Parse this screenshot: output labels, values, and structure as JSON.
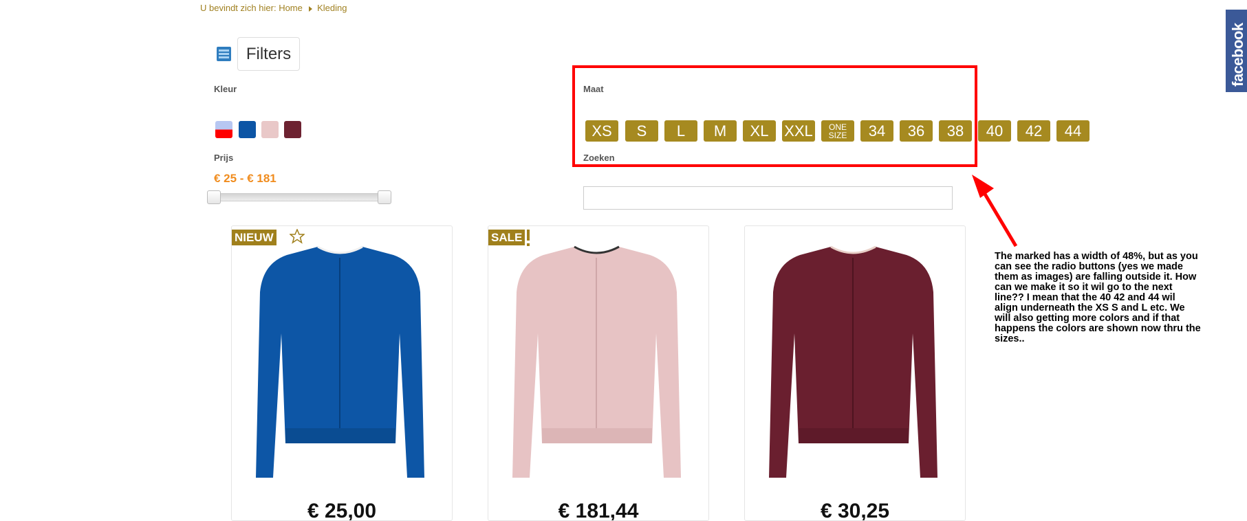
{
  "breadcrumb": {
    "prefix": "U bevindt zich hier:",
    "home": "Home",
    "current": "Kleding"
  },
  "filters": {
    "title": "Filters",
    "kleur_label": "Kleur",
    "colors": [
      "#b7c7f2/#ff0000",
      "#0c55a5",
      "#e9c8c8",
      "#6d2231"
    ],
    "prijs_label": "Prijs",
    "price_range": "€ 25 - € 181",
    "maat_label": "Maat",
    "sizes": [
      "XS",
      "S",
      "L",
      "M",
      "XL",
      "XXL",
      "ONE SIZE",
      "34",
      "36",
      "38",
      "40",
      "42",
      "44"
    ],
    "zoeken_label": "Zoeken"
  },
  "products": [
    {
      "badge": "NIEUW",
      "price": "€ 25,00",
      "color": "#0d56a6"
    },
    {
      "badge": "SALE",
      "price": "€ 181,44",
      "color": "#e7c3c4"
    },
    {
      "badge": "",
      "price": "€ 30,25",
      "color": "#6a1f2f"
    }
  ],
  "annotation": "The marked has a width of 48%, but as you can see the radio buttons (yes we made them as images) are falling outside it. How can we make it so it wil go to the next line?? I mean that the 40 42 and 44 wil align underneath the XS S and L etc. We will also getting more colors and if that happens the colors are shown now thru the sizes..",
  "facebook": "facebook",
  "colors": {
    "accent": "#a68a20",
    "price_orange": "#f08c1e",
    "highlight": "#ff0000",
    "facebook": "#3b5998"
  }
}
